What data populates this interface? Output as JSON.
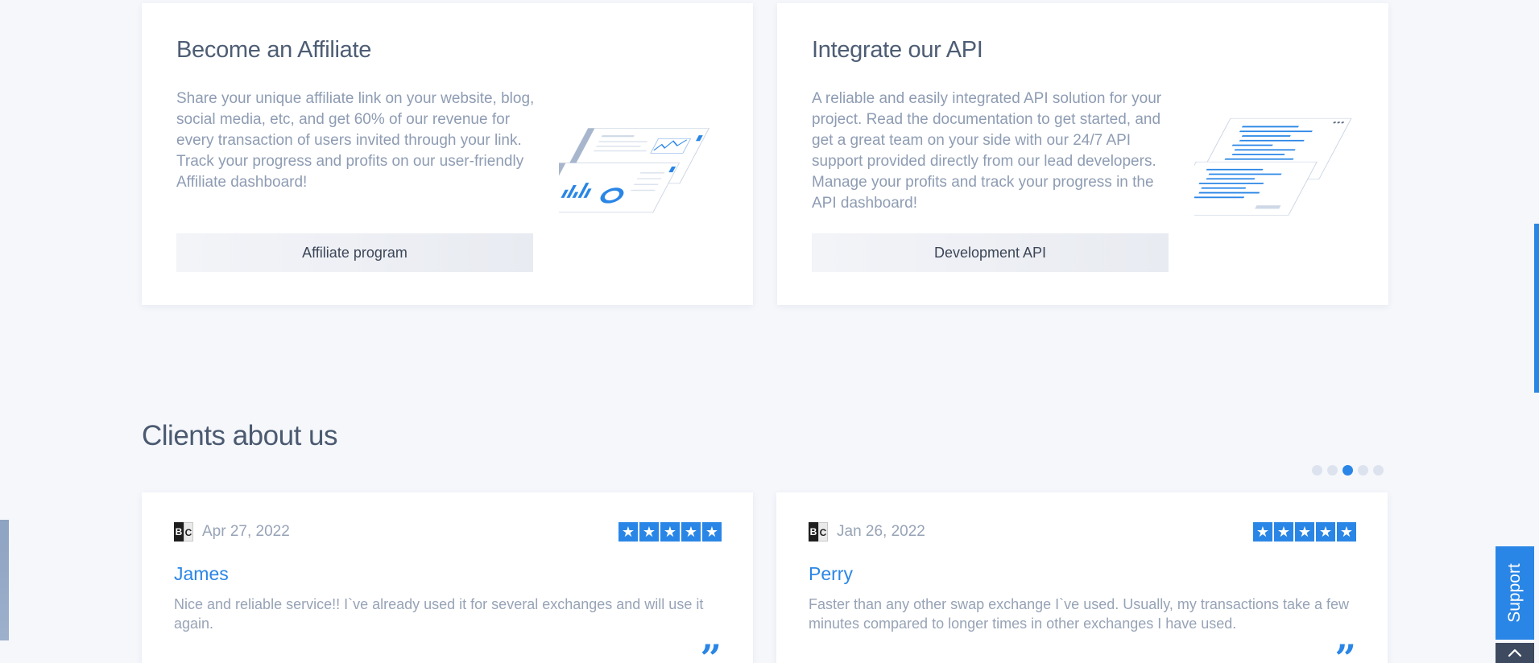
{
  "affiliate": {
    "title": "Become an Affiliate",
    "description": "Share your unique affiliate link on your website, blog, social media, etc, and get 60% of our revenue for every transaction of users invited through your link. Track your progress and profits on our user-friendly Affiliate dashboard!",
    "button_label": "Affiliate program"
  },
  "api": {
    "title": "Integrate our API",
    "description": "A reliable and easily integrated API solution for your project. Read the documentation to get started, and get a great team on your side with our 24/7 API support provided directly from our lead developers. Manage your profits and track your progress in the API dashboard!",
    "button_label": "Development API"
  },
  "clients": {
    "title": "Clients about us",
    "pagination": {
      "count": 5,
      "active_index": 2
    },
    "reviews": [
      {
        "logo": {
          "b": "B",
          "c": "C"
        },
        "date": "Apr 27, 2022",
        "rating": 5,
        "name": "James",
        "text": "Nice and reliable service!! I`ve already used it for several exchanges and will use it again."
      },
      {
        "logo": {
          "b": "B",
          "c": "C"
        },
        "date": "Jan 26, 2022",
        "rating": 5,
        "name": "Perry",
        "text": "Faster than any other swap exchange I`ve used. Usually, my transactions take a few minutes compared to longer times in other exchanges I have used."
      }
    ]
  },
  "support": {
    "label": "Support"
  },
  "icons": {
    "star": "star-icon",
    "quote": "quote-icon",
    "scroll_top": "chevron-up-icon"
  },
  "colors": {
    "accent": "#2a86e6",
    "title": "#4d5d74",
    "muted_text": "#8e9cb3",
    "support_dark": "#3d4a5f"
  }
}
